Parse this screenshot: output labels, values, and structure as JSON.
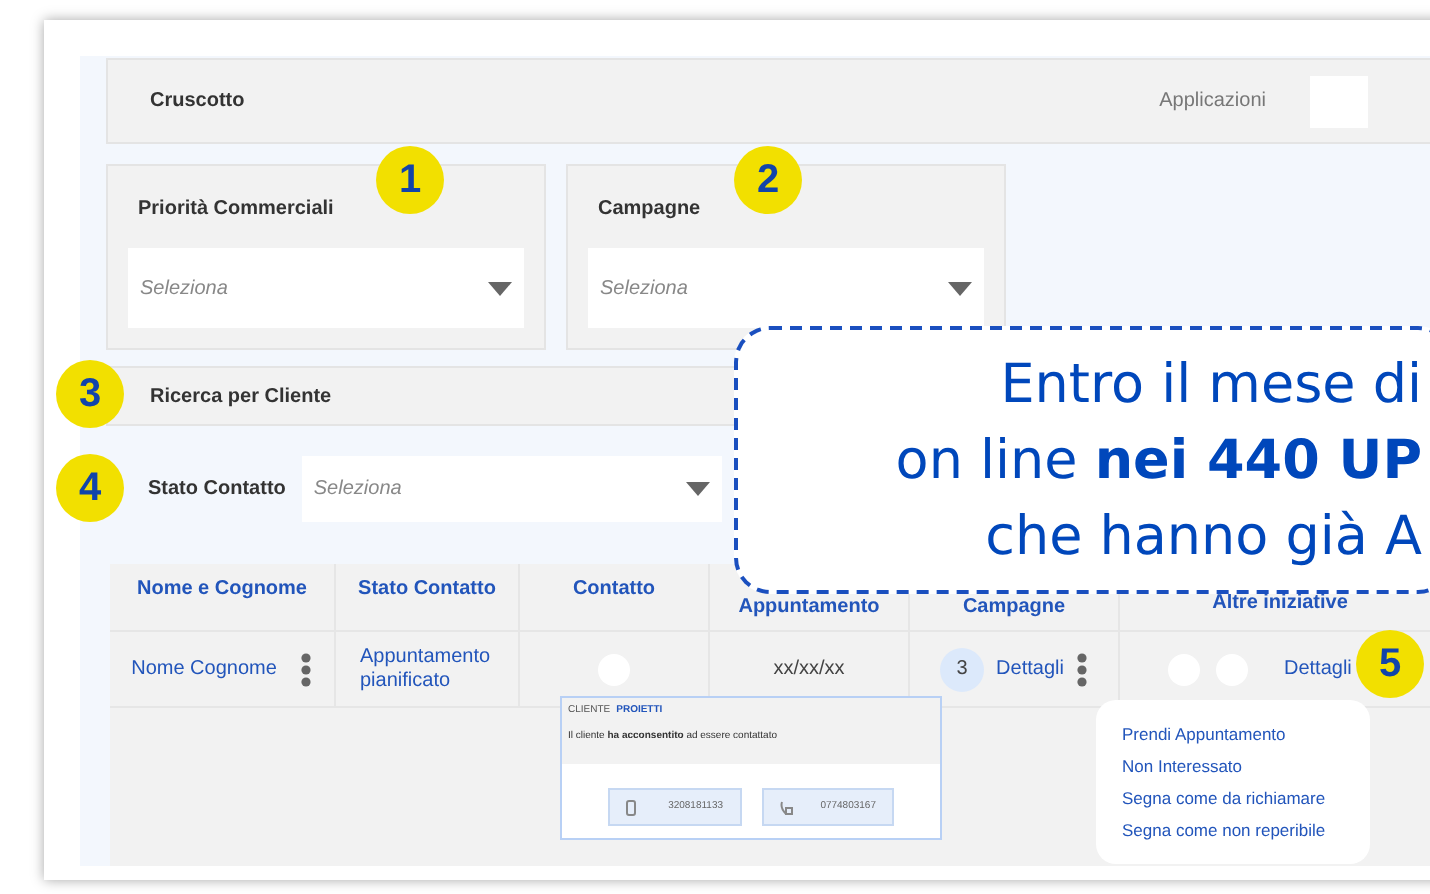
{
  "top_bar": {
    "title": "Cruscotto",
    "apps_label": "Applicazioni"
  },
  "filters": [
    {
      "label": "Priorità Commerciali",
      "placeholder": "Seleziona",
      "marker": "1"
    },
    {
      "label": "Campagne",
      "placeholder": "Seleziona",
      "marker": "2"
    }
  ],
  "search_section": {
    "title": "Ricerca per Cliente",
    "marker": "3"
  },
  "status_filter": {
    "label": "Stato Contatto",
    "placeholder": "Seleziona",
    "marker": "4"
  },
  "table": {
    "columns": [
      "Nome e Cognome",
      "Stato Contatto",
      "Contatto",
      "Appuntamento",
      "Campagne",
      "Altre iniziative"
    ],
    "rows": [
      {
        "name": "Nome Cognome",
        "status": "Appuntamento pianificato",
        "appointment": "xx/xx/xx",
        "campaign_count": "3",
        "campaign_link": "Dettagli",
        "other_link": "Dettagli",
        "marker": "5"
      }
    ]
  },
  "contact_popup": {
    "client_label": "CLIENTE",
    "client_name": "PROIETTI",
    "message": "Il cliente **ha acconsentito** ad essere contattato",
    "phones": [
      {
        "kind": "mobile",
        "number": "3208181133"
      },
      {
        "kind": "landline",
        "number": "0774803167"
      }
    ]
  },
  "action_menu": {
    "items": [
      "Prendi Appuntamento",
      "Non Interessato",
      "Segna come da richiamare",
      "Segna come non reperibile"
    ]
  },
  "callout": {
    "lines": [
      "Entro il mese di",
      "on line **nei 440 UP**",
      "che hanno già A"
    ]
  }
}
